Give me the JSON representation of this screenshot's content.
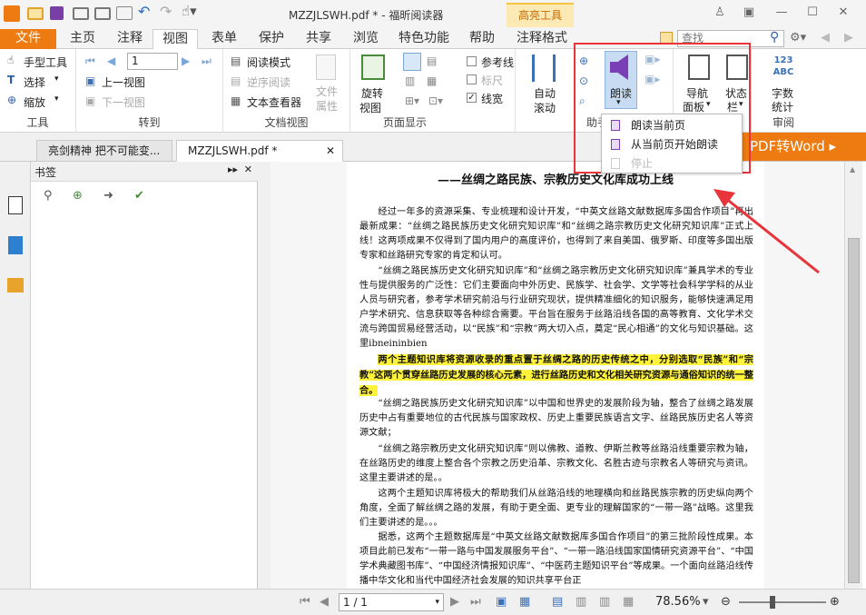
{
  "window": {
    "title": "MZZJLSWH.pdf * - 福昕阅读器",
    "context_tab": "高亮工具"
  },
  "tabs": [
    "文件",
    "主页",
    "注释",
    "视图",
    "表单",
    "保护",
    "共享",
    "浏览",
    "特色功能",
    "帮助",
    "注释格式"
  ],
  "active_tab": "视图",
  "search": {
    "placeholder": "查找"
  },
  "ribbon": {
    "tools": {
      "hand": "手型工具",
      "select": "选择",
      "zoom": "缩放",
      "label": "工具"
    },
    "goto": {
      "page_value": "1",
      "prev_view": "上一视图",
      "next_view": "下一视图",
      "label": "转到"
    },
    "docview": {
      "read_mode": "阅读模式",
      "reverse_read": "逆序阅读",
      "text_viewer": "文本查看器",
      "doc_attr": "文件",
      "doc_attr2": "属性",
      "label": "文档视图"
    },
    "pagedisplay": {
      "rotate": "旋转",
      "rotate2": "视图",
      "label": "页面显示"
    },
    "options": {
      "ref_line": "参考线",
      "ruler": "标尺",
      "line_width": "线宽"
    },
    "autoscroll": {
      "line1": "自动",
      "line2": "滚动"
    },
    "assistant": {
      "read": "朗读",
      "label": "助手"
    },
    "nav": {
      "line1": "导航",
      "line2": "面板"
    },
    "status": {
      "line1": "状态",
      "line2": "栏"
    },
    "wordcount": {
      "line1": "字数",
      "line2": "统计",
      "label": "审阅",
      "icon_text": "123\nABC"
    }
  },
  "dropdown": {
    "items": [
      "朗读当前页",
      "从当前页开始朗读",
      "停止"
    ]
  },
  "doc_tabs": [
    "亮剑精神 把不可能变...",
    "MZZJLSWH.pdf *"
  ],
  "promo": "PDF转Word ▸",
  "bookmarks": {
    "title": "书签"
  },
  "document": {
    "title": "——丝绸之路民族、宗教历史文化库成功上线",
    "p1": "经过一年多的资源采集、专业梳理和设计开发，“中英文丝路文献数据库多国合作项目”再出最新成果：“丝绸之路民族历史文化研究知识库”和“丝绸之路宗教历史文化研究知识库”正式上线！这两项成果不仅得到了国内用户的高度评价，也得到了来自美国、俄罗斯、印度等多国出版专家和丝路研究专家的肯定和认可。",
    "p2": "“丝绸之路民族历史文化研究知识库”和“丝绸之路宗教历史文化研究知识库”兼具学术的专业性与提供服务的广泛性：它们主要面向中外历史、民族学、社会学、文学等社会科学学科的从业人员与研究者，参考学术研究前沿与行业研究现状，提供精准细化的知识服务，能够快速满足用户学术研究、信息获取等各种综合需要。平台旨在服务于丝路沿线各国的高等教育、文化学术交流与跨国贸易经营活动，以“民族”和“宗教”两大切入点，奠定“民心相通”的文化与知识基础。这里ibneininbien",
    "p3_highlight": "两个主题知识库将资源收录的重点置于丝绸之路的历史传统之中，分别选取“民族”和“宗教”这两个贯穿丝路历史发展的核心元素，进行丝路历史和文化相关研究资源与通俗知识的统一整合。",
    "p4": "“丝绸之路民族历史文化研究知识库”以中国和世界史的发展阶段为轴，整合了丝绸之路发展历史中占有重要地位的古代民族与国家政权、历史上重要民族语言文字、丝路民族历史名人等资源文献；",
    "p5": "“丝绸之路宗教历史文化研究知识库”则以佛教、道教、伊斯兰教等丝路沿线重要宗教为轴，在丝路历史的维度上整合各个宗教之历史沿革、宗教文化、名胜古迹与宗教名人等研究与资讯。这里主要讲述的是。。",
    "p6": "这两个主题知识库将极大的帮助我们从丝路沿线的地理横向和丝路民族宗教的历史纵向两个角度，全面了解丝绸之路的发展，有助于更全面、更专业的理解国家的“一带一路”战略。这里我们主要讲述的是。。。",
    "p7": "据悉，这两个主题数据库是“中英文丝路文献数据库多国合作项目”的第三批阶段性成果。本项目此前已发布“一带一路与中国发展服务平台”、“一带一路沿线国家国情研究资源平台”、“中国学术典藏图书库”、“中国经济情报知识库”、“中医药主题知识平台”等成果。一个面向丝路沿线传播中华文化和当代中国经济社会发展的知识共享平台正"
  },
  "statusbar": {
    "page_field": "1 / 1",
    "zoom": "78.56%"
  },
  "colors": {
    "accent": "#ee7b12",
    "highlight": "#fff23a",
    "annotation_red": "#e8343a",
    "speaker_purple": "#7b3fb5"
  }
}
